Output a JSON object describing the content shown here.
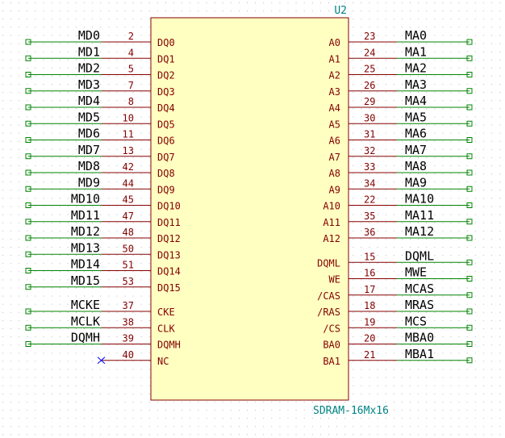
{
  "component": {
    "reference": "U2",
    "value": "SDRAM-16Mx16"
  },
  "colors": {
    "background": "#ffffff",
    "grid_dot": "#b8b8b8",
    "body_fill": "#ffffc2",
    "body_stroke": "#840000",
    "pin_line": "#840000",
    "pin_text": "#840000",
    "wire": "#008400",
    "net_label": "#000000",
    "ref_text": "#008484",
    "noconnect": "#0000ff"
  },
  "left_pins": [
    {
      "name": "DQ0",
      "num": "2",
      "net": "MD0"
    },
    {
      "name": "DQ1",
      "num": "4",
      "net": "MD1"
    },
    {
      "name": "DQ2",
      "num": "5",
      "net": "MD2"
    },
    {
      "name": "DQ3",
      "num": "7",
      "net": "MD3"
    },
    {
      "name": "DQ4",
      "num": "8",
      "net": "MD4"
    },
    {
      "name": "DQ5",
      "num": "10",
      "net": "MD5"
    },
    {
      "name": "DQ6",
      "num": "11",
      "net": "MD6"
    },
    {
      "name": "DQ7",
      "num": "13",
      "net": "MD7"
    },
    {
      "name": "DQ8",
      "num": "42",
      "net": "MD8"
    },
    {
      "name": "DQ9",
      "num": "44",
      "net": "MD9"
    },
    {
      "name": "DQ10",
      "num": "45",
      "net": "MD10"
    },
    {
      "name": "DQ11",
      "num": "47",
      "net": "MD11"
    },
    {
      "name": "DQ12",
      "num": "48",
      "net": "MD12"
    },
    {
      "name": "DQ13",
      "num": "50",
      "net": "MD13"
    },
    {
      "name": "DQ14",
      "num": "51",
      "net": "MD14"
    },
    {
      "name": "DQ15",
      "num": "53",
      "net": "MD15"
    },
    {
      "name": "CKE",
      "num": "37",
      "net": "MCKE"
    },
    {
      "name": "CLK",
      "num": "38",
      "net": "MCLK"
    },
    {
      "name": "DQMH",
      "num": "39",
      "net": "DQMH"
    },
    {
      "name": "NC",
      "num": "40",
      "net": "",
      "noconnect": true
    }
  ],
  "right_pins": [
    {
      "name": "A0",
      "num": "23",
      "net": "MA0"
    },
    {
      "name": "A1",
      "num": "24",
      "net": "MA1"
    },
    {
      "name": "A2",
      "num": "25",
      "net": "MA2"
    },
    {
      "name": "A3",
      "num": "26",
      "net": "MA3"
    },
    {
      "name": "A4",
      "num": "29",
      "net": "MA4"
    },
    {
      "name": "A5",
      "num": "30",
      "net": "MA5"
    },
    {
      "name": "A6",
      "num": "31",
      "net": "MA6"
    },
    {
      "name": "A7",
      "num": "32",
      "net": "MA7"
    },
    {
      "name": "A8",
      "num": "33",
      "net": "MA8"
    },
    {
      "name": "A9",
      "num": "34",
      "net": "MA9"
    },
    {
      "name": "A10",
      "num": "22",
      "net": "MA10"
    },
    {
      "name": "A11",
      "num": "35",
      "net": "MA11"
    },
    {
      "name": "A12",
      "num": "36",
      "net": "MA12"
    },
    {
      "name": "DQML",
      "num": "15",
      "net": "DQML"
    },
    {
      "name": "WE",
      "num": "16",
      "net": "MWE"
    },
    {
      "name": "/CAS",
      "num": "17",
      "net": "MCAS"
    },
    {
      "name": "/RAS",
      "num": "18",
      "net": "MRAS"
    },
    {
      "name": "/CS",
      "num": "19",
      "net": "MCS"
    },
    {
      "name": "BA0",
      "num": "20",
      "net": "MBA0"
    },
    {
      "name": "BA1",
      "num": "21",
      "net": "MBA1"
    }
  ]
}
